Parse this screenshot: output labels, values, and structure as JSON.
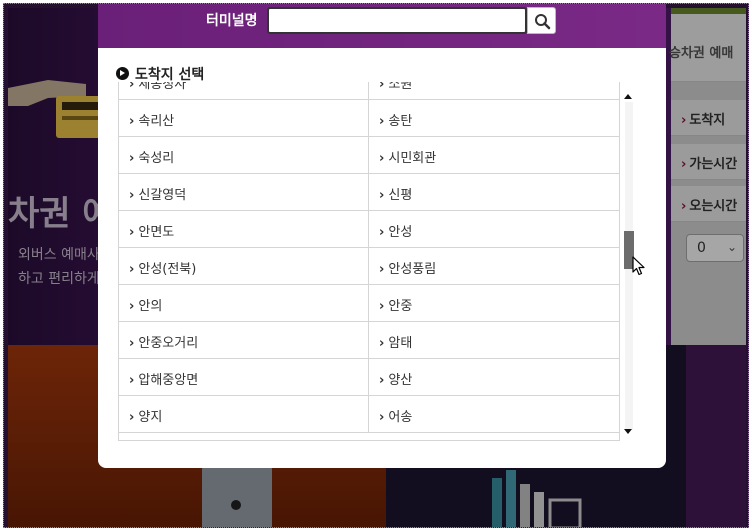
{
  "background": {
    "hero_title": "차권 예",
    "hero_sub_line1": "외버스 예매사",
    "hero_sub_line2": "하고 편리하게",
    "right_panel": {
      "header": "승차권 예매",
      "rows": [
        {
          "label": "도착지"
        },
        {
          "label": "가는시간"
        },
        {
          "label": "오는시간"
        }
      ],
      "select_value": "0"
    }
  },
  "modal": {
    "search": {
      "label": "터미널명",
      "value": "",
      "icon": "search-icon"
    },
    "section_title": "도착지 선택",
    "rows": [
      [
        "세종청사",
        "소원"
      ],
      [
        "속리산",
        "송탄"
      ],
      [
        "숙성리",
        "시민회관"
      ],
      [
        "신갈영덕",
        "신평"
      ],
      [
        "안면도",
        "안성"
      ],
      [
        "안성(전북)",
        "안성풍림"
      ],
      [
        "안의",
        "안중"
      ],
      [
        "안중오거리",
        "암태"
      ],
      [
        "압해중앙면",
        "양산"
      ],
      [
        "양지",
        "어송"
      ]
    ],
    "arrow_glyph": "›",
    "scroll_position": 0.42
  },
  "colors": {
    "modal_header": "#6a1f78",
    "scroll_thumb": "#6c6c6c"
  }
}
